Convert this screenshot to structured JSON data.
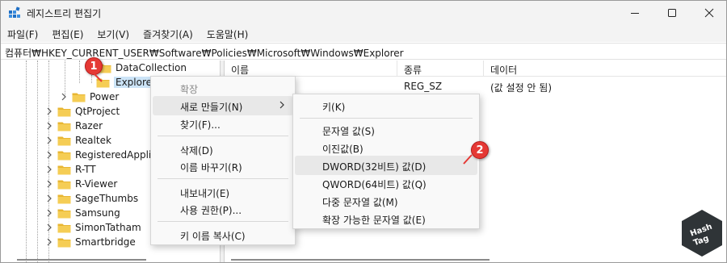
{
  "window": {
    "title": "레지스트리 편집기",
    "controls": {
      "minimize": "minimize-icon",
      "maximize": "maximize-icon",
      "close": "close-icon"
    }
  },
  "menubar": {
    "items": [
      {
        "label": "파일(F)"
      },
      {
        "label": "편집(E)"
      },
      {
        "label": "보기(V)"
      },
      {
        "label": "즐겨찾기(A)"
      },
      {
        "label": "도움말(H)"
      }
    ]
  },
  "address": {
    "path": "컴퓨터₩HKEY_CURRENT_USER₩Software₩Policies₩Microsoft₩Windows₩Explorer"
  },
  "tree": {
    "items": [
      {
        "label": "DataCollection"
      },
      {
        "label": "Explorer"
      },
      {
        "label": "Power"
      },
      {
        "label": "QtProject"
      },
      {
        "label": "Razer"
      },
      {
        "label": "Realtek"
      },
      {
        "label": "RegisteredApplica"
      },
      {
        "label": "R-TT"
      },
      {
        "label": "R-Viewer"
      },
      {
        "label": "SageThumbs"
      },
      {
        "label": "Samsung"
      },
      {
        "label": "SimonTatham"
      },
      {
        "label": "Smartbridge"
      }
    ]
  },
  "list": {
    "columns": [
      "이름",
      "종류",
      "데이터"
    ],
    "rows": [
      {
        "name": "",
        "type": "REG_SZ",
        "data": "(값 설정 안 됨)"
      }
    ]
  },
  "context_menu": {
    "items": [
      {
        "label": "확장"
      },
      {
        "label": "새로 만들기(N)"
      },
      {
        "label": "찾기(F)..."
      },
      {
        "label": "삭제(D)"
      },
      {
        "label": "이름 바꾸기(R)"
      },
      {
        "label": "내보내기(E)"
      },
      {
        "label": "사용 권한(P)..."
      },
      {
        "label": "키 이름 복사(C)"
      }
    ]
  },
  "submenu": {
    "items": [
      {
        "label": "키(K)"
      },
      {
        "label": "문자열 값(S)"
      },
      {
        "label": "이진값(B)"
      },
      {
        "label": "DWORD(32비트) 값(D)"
      },
      {
        "label": "QWORD(64비트) 값(Q)"
      },
      {
        "label": "다중 문자열 값(M)"
      },
      {
        "label": "확장 가능한 문자열 값(E)"
      }
    ]
  },
  "annotations": {
    "step1": "1",
    "step2": "2"
  },
  "watermark": {
    "line1": "Hash",
    "line2": "Tag"
  },
  "colors": {
    "folder": "#e8b632",
    "selection": "#cce4f7",
    "badge": "#e53935",
    "watermark": "#2f3437"
  }
}
